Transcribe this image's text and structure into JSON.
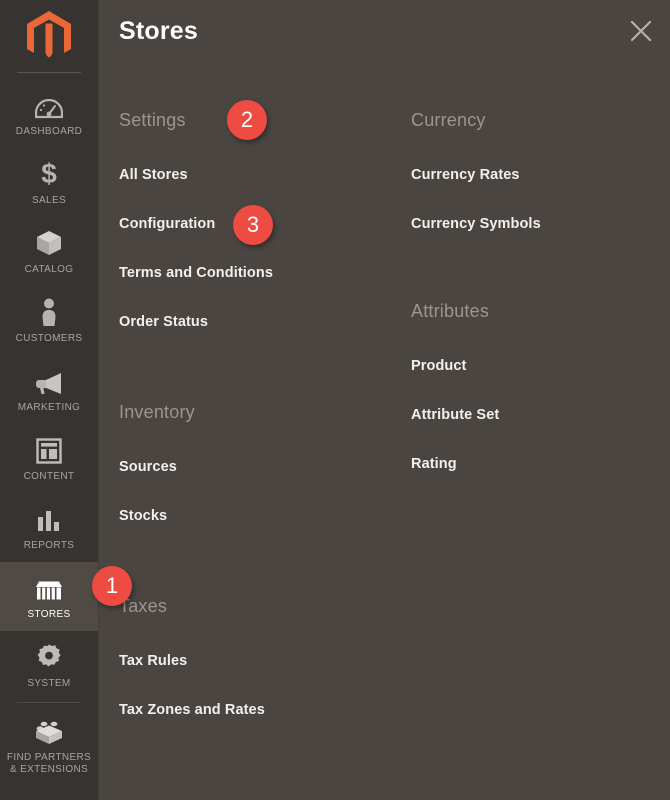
{
  "app": {
    "brand_logo": "magento-logo",
    "accent_orange": "#ec6737",
    "badge_red": "#ee4b42",
    "sidebar_bg": "#373330",
    "panel_bg": "#4a4541"
  },
  "sidebar": {
    "items": [
      {
        "label": "DASHBOARD",
        "icon": "dashboard-gauge-icon",
        "active": false
      },
      {
        "label": "SALES",
        "icon": "dollar-sign-icon",
        "active": false
      },
      {
        "label": "CATALOG",
        "icon": "box-icon",
        "active": false
      },
      {
        "label": "CUSTOMERS",
        "icon": "person-icon",
        "active": false
      },
      {
        "label": "MARKETING",
        "icon": "megaphone-icon",
        "active": false
      },
      {
        "label": "CONTENT",
        "icon": "layout-page-icon",
        "active": false
      },
      {
        "label": "REPORTS",
        "icon": "bar-chart-icon",
        "active": false
      },
      {
        "label": "STORES",
        "icon": "storefront-icon",
        "active": true
      },
      {
        "label": "SYSTEM",
        "icon": "gear-icon",
        "active": false
      },
      {
        "label": "FIND PARTNERS\n& EXTENSIONS",
        "label_line1": "FIND PARTNERS",
        "label_line2": "& EXTENSIONS",
        "icon": "lego-brick-icon",
        "active": false
      }
    ]
  },
  "panel": {
    "title": "Stores",
    "close_icon": "close-icon",
    "columns": [
      {
        "name": "left",
        "groups": [
          {
            "title": "Settings",
            "links": [
              "All Stores",
              "Configuration",
              "Terms and Conditions",
              "Order Status"
            ]
          },
          {
            "title": "Inventory",
            "links": [
              "Sources",
              "Stocks"
            ]
          },
          {
            "title": "Taxes",
            "links": [
              "Tax Rules",
              "Tax Zones and Rates"
            ]
          }
        ]
      },
      {
        "name": "right",
        "groups": [
          {
            "title": "Currency",
            "links": [
              "Currency Rates",
              "Currency Symbols"
            ]
          },
          {
            "title": "Attributes",
            "links": [
              "Product",
              "Attribute Set",
              "Rating"
            ]
          }
        ]
      }
    ]
  },
  "badges": [
    {
      "id": "badge-1",
      "number": "1",
      "target": "sidebar-item-stores"
    },
    {
      "id": "badge-2",
      "number": "2",
      "target": "group-title-settings"
    },
    {
      "id": "badge-3",
      "number": "3",
      "target": "link-configuration"
    }
  ]
}
